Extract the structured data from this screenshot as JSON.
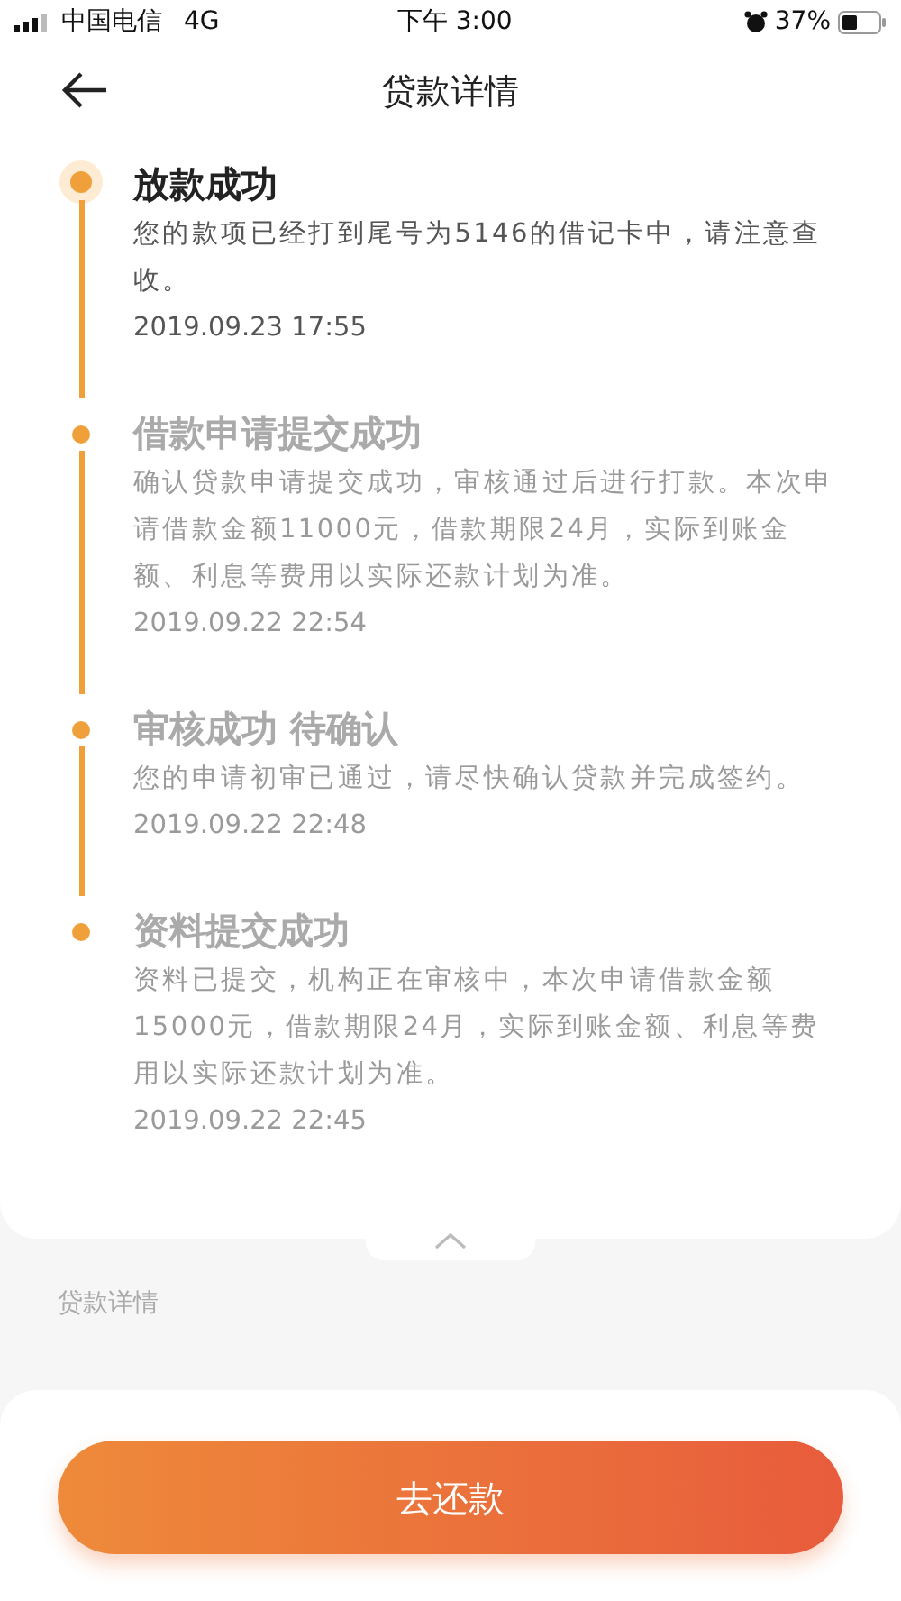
{
  "status_bar": {
    "carrier": "中国电信",
    "network": "4G",
    "time": "下午 3:00",
    "battery": "37%"
  },
  "header": {
    "title": "贷款详情"
  },
  "timeline": [
    {
      "title": "放款成功",
      "body": "您的款项已经打到尾号为5146的借记卡中，请注意查收。",
      "time": "2019.09.23 17:55",
      "current": true
    },
    {
      "title": "借款申请提交成功",
      "body": "确认贷款申请提交成功，审核通过后进行打款。本次申请借款金额11000元，借款期限24月，实际到账金额、利息等费用以实际还款计划为准。",
      "time": "2019.09.22 22:54",
      "current": false
    },
    {
      "title": "审核成功 待确认",
      "body": "您的申请初审已通过，请尽快确认贷款并完成签约。",
      "time": "2019.09.22 22:48",
      "current": false
    },
    {
      "title": "资料提交成功",
      "body": "资料已提交，机构正在审核中，本次申请借款金额15000元，借款期限24月，实际到账金额、利息等费用以实际还款计划为准。",
      "time": "2019.09.22 22:45",
      "current": false
    }
  ],
  "section_label": "贷款详情",
  "action_button": "去还款"
}
